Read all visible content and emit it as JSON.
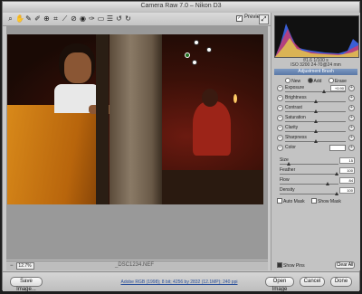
{
  "window": {
    "title": "Camera Raw 7.0  –  Nikon D3"
  },
  "toolbar": {
    "tools": [
      "zoom-icon",
      "hand-icon",
      "white-balance-icon",
      "color-sampler-icon",
      "targeted-adjustment-icon",
      "crop-icon",
      "straighten-icon",
      "spot-removal-icon",
      "red-eye-icon",
      "adjustment-brush-icon",
      "graduated-filter-icon",
      "preferences-icon",
      "rotate-ccw-icon",
      "rotate-cw-icon"
    ],
    "preview_label": "Preview",
    "preview_checked": true,
    "fullscreen_icon": "fullscreen-icon"
  },
  "bottom": {
    "zoom": "12.7%",
    "filename": "_DSC1234.NEF"
  },
  "info": {
    "line1": "f/1.6   1/100 s",
    "line2": "ISO 3200   24-70@24 mm"
  },
  "panel": {
    "title": "Adjustment Brush",
    "modes": [
      {
        "label": "New",
        "selected": false
      },
      {
        "label": "Add",
        "selected": true
      },
      {
        "label": "Erase",
        "selected": false
      }
    ],
    "sliders": [
      {
        "label": "Exposure",
        "value": "+0.90",
        "pos": 0.62
      },
      {
        "label": "Brightness",
        "value": "0",
        "pos": 0.5
      },
      {
        "label": "Contrast",
        "value": "0",
        "pos": 0.5
      },
      {
        "label": "Saturation",
        "value": "0",
        "pos": 0.5
      },
      {
        "label": "Clarity",
        "value": "0",
        "pos": 0.5
      },
      {
        "label": "Sharpness",
        "value": "0",
        "pos": 0.5
      },
      {
        "label": "Color",
        "value": "",
        "pos": 0.5
      }
    ],
    "brush": [
      {
        "label": "Size",
        "value": "15",
        "pos": 0.15
      },
      {
        "label": "Feather",
        "value": "100",
        "pos": 1.0
      },
      {
        "label": "Flow",
        "value": "84",
        "pos": 0.84
      },
      {
        "label": "Density",
        "value": "100",
        "pos": 1.0
      }
    ],
    "auto_mask": "Auto Mask",
    "show_mask": "Show Mask",
    "show_pins": "Show Pins",
    "clear_all": "Clear All"
  },
  "footer": {
    "save": "Save Image...",
    "workflow": "Adobe RGB (1998); 8 bit; 4256 by 2832 (12.1MP); 240 ppi",
    "open": "Open Image",
    "cancel": "Cancel",
    "done": "Done"
  },
  "colors": {
    "accent": "#5a78a6",
    "histogram_bg": "#111111"
  }
}
